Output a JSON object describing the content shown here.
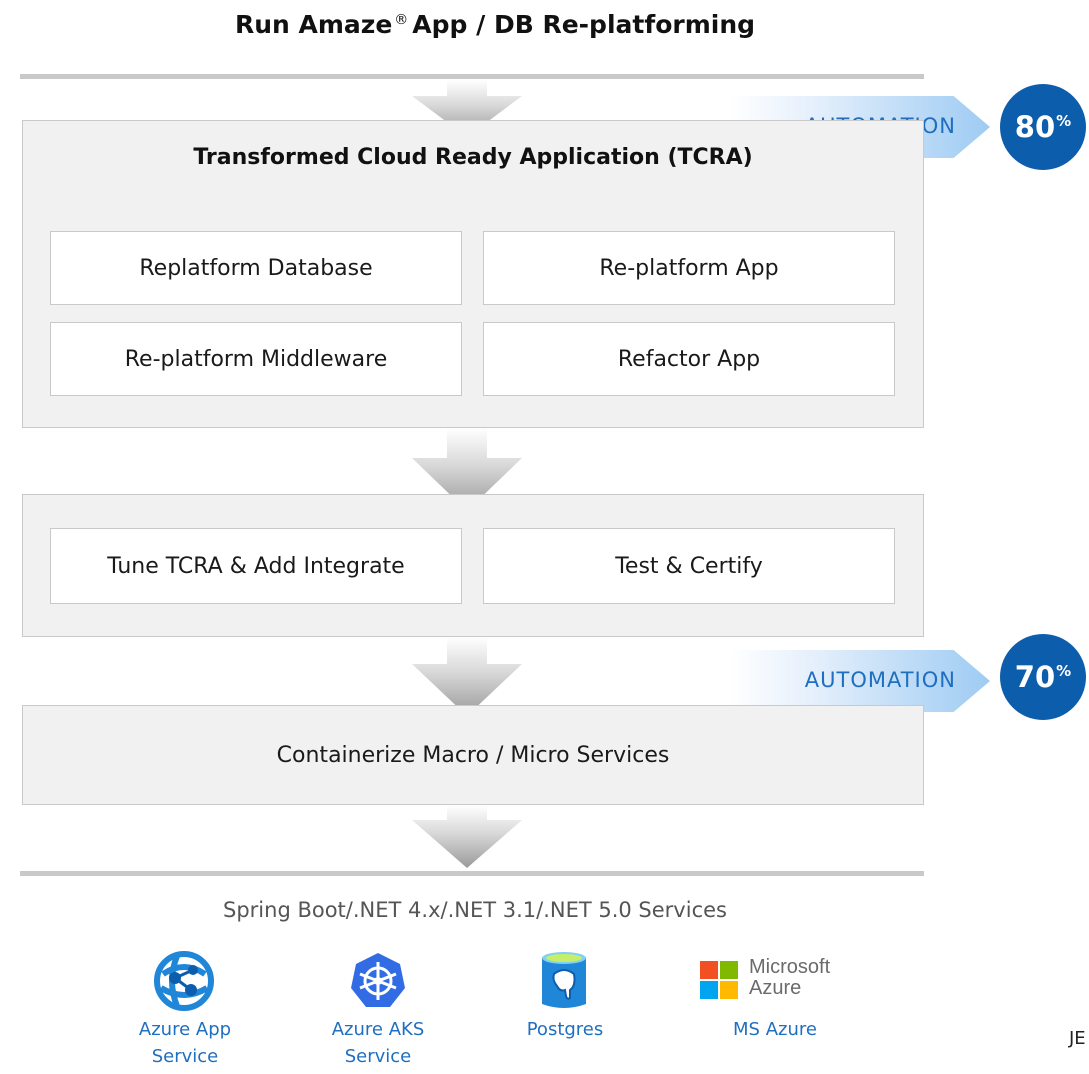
{
  "title": {
    "part1": "Run Amaze",
    "registered": "®",
    "part2": "App / DB Re-platforming"
  },
  "automation": [
    {
      "label": "AUTOMATION",
      "percent": "80",
      "percent_sign": "%"
    },
    {
      "label": "AUTOMATION",
      "percent": "70",
      "percent_sign": "%"
    }
  ],
  "tcra": {
    "title": "Transformed Cloud Ready Application (TCRA)",
    "boxes": [
      "Replatform Database",
      "Re-platform App",
      "Re-platform Middleware",
      "Refactor App"
    ]
  },
  "stage2": {
    "boxes": [
      "Tune TCRA & Add Integrate",
      "Test & Certify"
    ]
  },
  "stage3": {
    "label": "Containerize Macro / Micro Services"
  },
  "services_line": "Spring Boot/.NET 4.x/.NET 3.1/.NET 5.0 Services",
  "platforms": [
    {
      "icon": "azure-app-service-icon",
      "line1": "Azure App",
      "line2": "Service"
    },
    {
      "icon": "azure-aks-icon",
      "line1": "Azure AKS",
      "line2": "Service"
    },
    {
      "icon": "postgres-icon",
      "line1": "Postgres",
      "line2": ""
    },
    {
      "icon": "microsoft-azure-logo",
      "line1": "MS Azure",
      "line2": "",
      "logo_line1": "Microsoft",
      "logo_line2": "Azure"
    }
  ],
  "edge_fragment": "JE",
  "colors": {
    "accent_blue": "#1f6fc0",
    "badge_blue": "#0d5dad",
    "panel_gray": "#f1f1f1",
    "line_gray": "#c9c9c9"
  }
}
